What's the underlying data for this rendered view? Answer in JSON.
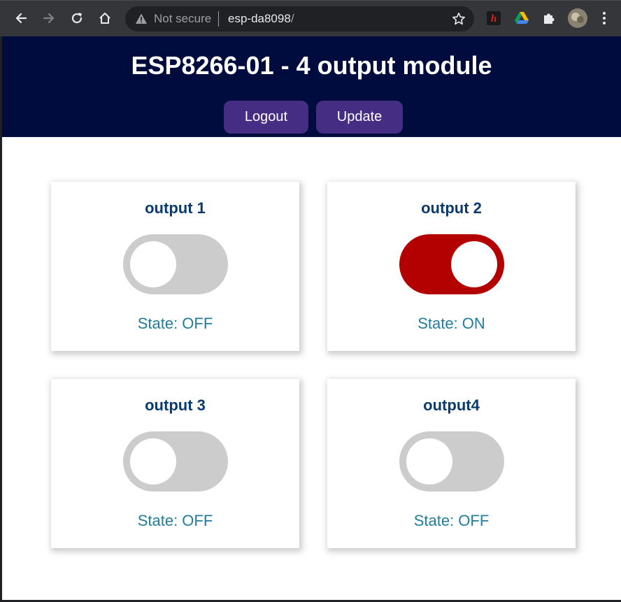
{
  "browser": {
    "security_label": "Not secure",
    "url_host": "esp-da8098",
    "url_path": "/",
    "icons": {
      "back": "arrow-left-icon",
      "forward": "arrow-right-icon",
      "reload": "reload-icon",
      "home": "home-icon",
      "warning": "warning-icon",
      "star": "star-icon",
      "extension1": "h-extension-icon",
      "extension2": "drive-icon",
      "extensions": "puzzle-icon",
      "profile": "avatar",
      "menu": "kebab-menu-icon"
    }
  },
  "header": {
    "title": "ESP8266-01 - 4 output module",
    "logout_label": "Logout",
    "update_label": "Update"
  },
  "cards": [
    {
      "title": "output 1",
      "state_text": "State: OFF",
      "on": false
    },
    {
      "title": "output 2",
      "state_text": "State: ON",
      "on": true
    },
    {
      "title": "output 3",
      "state_text": "State: OFF",
      "on": false
    },
    {
      "title": "output4",
      "state_text": "State: OFF",
      "on": false
    }
  ],
  "colors": {
    "nav_background": "#000c3d",
    "button_background": "#452d84",
    "switch_on": "#b30000",
    "switch_off": "#cccccc",
    "card_title": "#0b3b6e",
    "state_text": "#217d9b"
  }
}
